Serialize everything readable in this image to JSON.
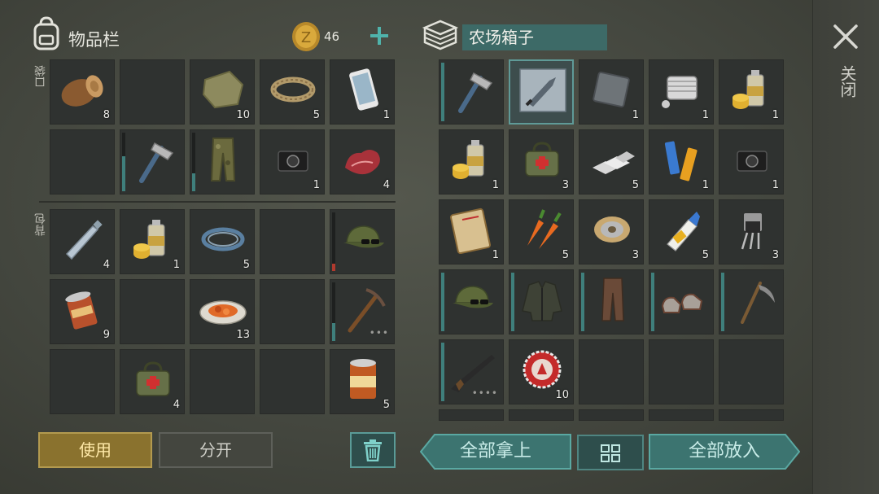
{
  "inventory": {
    "title": "物品栏",
    "coins": "46",
    "pocket_label": "口袋",
    "backpack_label": "背包",
    "pocket_slots": [
      {
        "item": "wood-log-icon",
        "qty": "8"
      },
      {
        "item": "",
        "qty": ""
      },
      {
        "item": "cloth-scrap-icon",
        "qty": "10"
      },
      {
        "item": "rope-icon",
        "qty": "5"
      },
      {
        "item": "smartphone-icon",
        "qty": "1"
      },
      {
        "item": "",
        "qty": ""
      },
      {
        "item": "hatchet-icon",
        "qty": "",
        "durability": 0.6,
        "dur_color": "#3f7f7c"
      },
      {
        "item": "camo-pants-icon",
        "qty": "",
        "durability": 0.3,
        "dur_color": "#3f7f7c"
      },
      {
        "item": "camera-icon",
        "qty": "1"
      },
      {
        "item": "raw-meat-icon",
        "qty": "4"
      }
    ],
    "backpack_slots": [
      {
        "item": "water-bottle-icon",
        "qty": "4"
      },
      {
        "item": "spray-paint-icon",
        "qty": "1"
      },
      {
        "item": "wire-coil-icon",
        "qty": "5"
      },
      {
        "item": "",
        "qty": ""
      },
      {
        "item": "camo-cap-icon",
        "qty": "",
        "durability": 0.12,
        "dur_color": "#b03a2e"
      },
      {
        "item": "open-can-icon",
        "qty": "9"
      },
      {
        "item": "",
        "qty": ""
      },
      {
        "item": "cooked-meal-icon",
        "qty": "13"
      },
      {
        "item": "",
        "qty": ""
      },
      {
        "item": "pickaxe-icon",
        "qty": "",
        "durability": 0.3,
        "dur_color": "#3f7f7c",
        "dots": "•••"
      },
      {
        "item": "",
        "qty": ""
      },
      {
        "item": "medkit-bag-icon",
        "qty": "4"
      },
      {
        "item": "",
        "qty": ""
      },
      {
        "item": "",
        "qty": ""
      },
      {
        "item": "canned-food-icon",
        "qty": "5"
      }
    ],
    "use_label": "使用",
    "split_label": "分开"
  },
  "farm_box": {
    "title": "农场箱子",
    "slots": [
      {
        "item": "hatchet-icon",
        "qty": "",
        "durability": 1.0,
        "dur_color": "#3f7f7c"
      },
      {
        "item": "machete-blueprint-icon",
        "qty": "",
        "selected": true
      },
      {
        "item": "metal-plate-icon",
        "qty": "1"
      },
      {
        "item": "engine-part-icon",
        "qty": "1"
      },
      {
        "item": "spray-paint-icon",
        "qty": "1"
      },
      {
        "item": "spray-paint-icon",
        "qty": "1"
      },
      {
        "item": "medkit-bag-icon",
        "qty": "3"
      },
      {
        "item": "silver-bars-icon",
        "qty": "5"
      },
      {
        "item": "batteries-icon",
        "qty": "1"
      },
      {
        "item": "camera-icon",
        "qty": "1"
      },
      {
        "item": "diary-icon",
        "qty": "1"
      },
      {
        "item": "carrots-icon",
        "qty": "5"
      },
      {
        "item": "wire-spool-icon",
        "qty": "3"
      },
      {
        "item": "glue-icon",
        "qty": "5"
      },
      {
        "item": "transistor-icon",
        "qty": "3"
      },
      {
        "item": "camo-cap-icon",
        "qty": "",
        "durability": 1.0,
        "dur_color": "#3f7f7c"
      },
      {
        "item": "jacket-icon",
        "qty": "",
        "durability": 1.0,
        "dur_color": "#3f7f7c"
      },
      {
        "item": "leather-pants-icon",
        "qty": "",
        "durability": 1.0,
        "dur_color": "#3f7f7c"
      },
      {
        "item": "shoes-icon",
        "qty": "",
        "durability": 1.0,
        "dur_color": "#3f7f7c"
      },
      {
        "item": "scythe-icon",
        "qty": "",
        "durability": 1.0,
        "dur_color": "#3f7f7c"
      },
      {
        "item": "shotgun-icon",
        "qty": "",
        "durability": 1.0,
        "dur_color": "#3f7f7c",
        "dots": "••••"
      },
      {
        "item": "bottle-cap-icon",
        "qty": "10"
      },
      {
        "item": "",
        "qty": ""
      },
      {
        "item": "",
        "qty": ""
      },
      {
        "item": "",
        "qty": ""
      }
    ],
    "take_all_label": "全部拿上",
    "put_all_label": "全部放入"
  },
  "close_label": "关闭",
  "colors": {
    "accent_teal": "#3d6a67",
    "use_gold": "#8a722e",
    "durability_red": "#b03a2e"
  }
}
